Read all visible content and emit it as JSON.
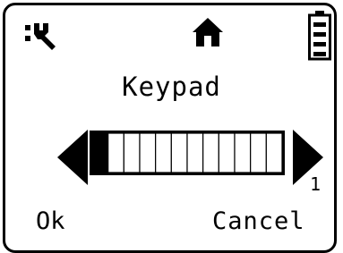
{
  "status_bar": {
    "left_icon": "wrench-icon",
    "center_icon": "home-icon",
    "right_icon": "battery-icon"
  },
  "screen": {
    "title": "Keypad"
  },
  "slider": {
    "segments": 12,
    "level": 1,
    "level_label": "1"
  },
  "softkeys": {
    "left": "Ok",
    "right": "Cancel"
  },
  "colors": {
    "foreground": "#000000",
    "background": "#ffffff"
  }
}
